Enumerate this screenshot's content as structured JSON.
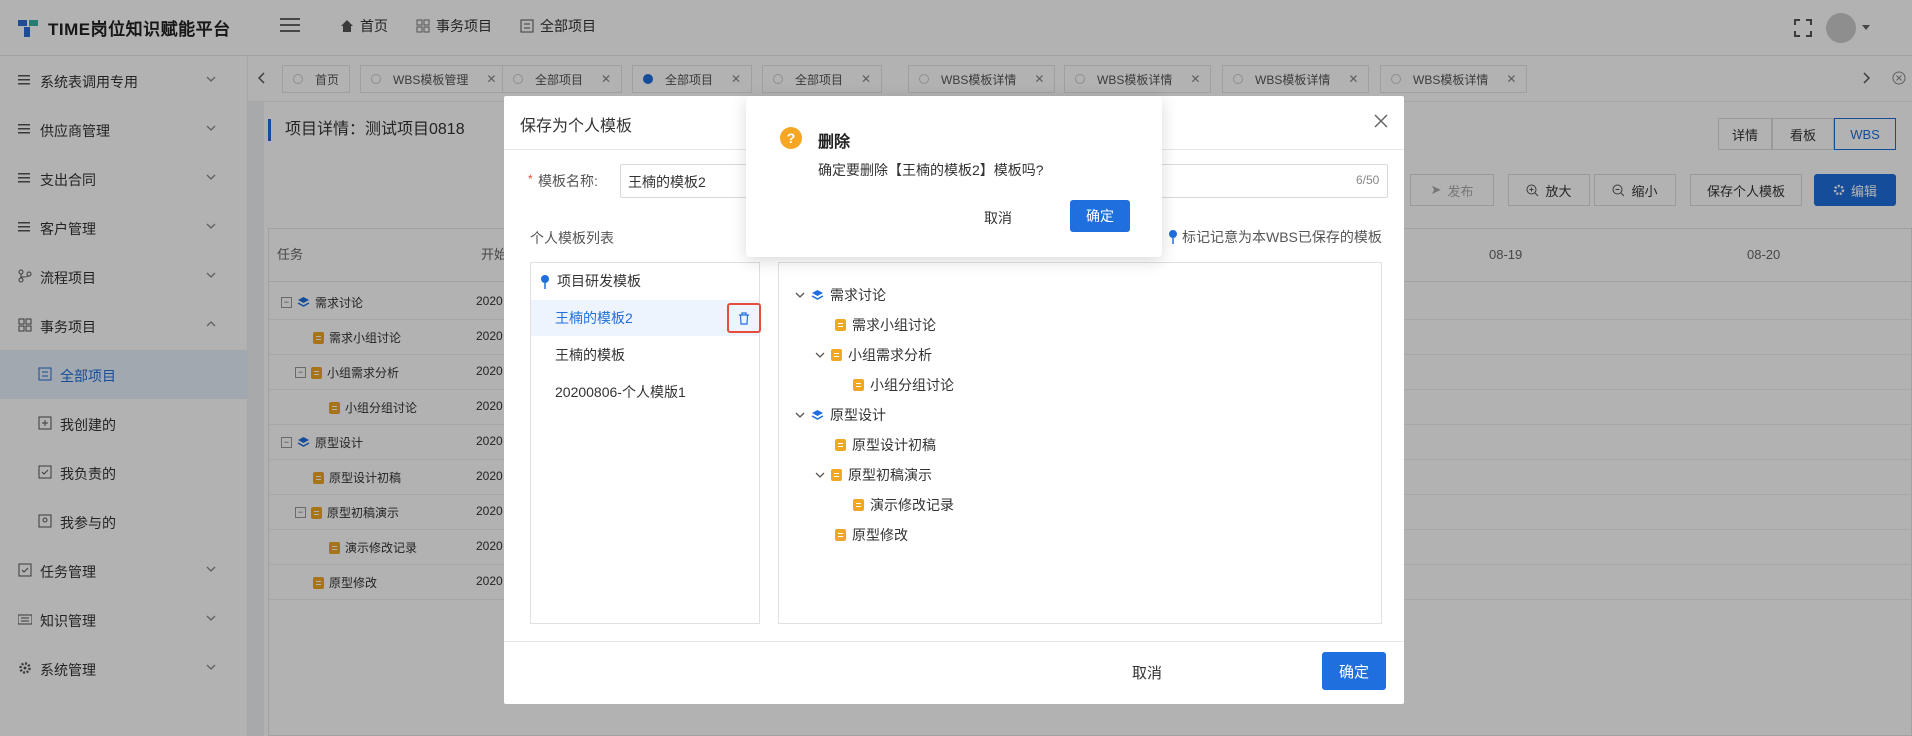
{
  "app": {
    "title": "TIME岗位知识赋能平台"
  },
  "topnav": {
    "home": "首页",
    "affairs": "事务项目",
    "all_projects": "全部项目"
  },
  "sidebar": {
    "items": [
      {
        "label": "系统表调用专用"
      },
      {
        "label": "供应商管理"
      },
      {
        "label": "支出合同"
      },
      {
        "label": "客户管理"
      },
      {
        "label": "流程项目"
      },
      {
        "label": "事务项目"
      },
      {
        "label": "全部项目"
      },
      {
        "label": "我创建的"
      },
      {
        "label": "我负责的"
      },
      {
        "label": "我参与的"
      },
      {
        "label": "任务管理"
      },
      {
        "label": "知识管理"
      },
      {
        "label": "系统管理"
      }
    ]
  },
  "tabs": [
    {
      "label": "首页"
    },
    {
      "label": "WBS模板管理"
    },
    {
      "label": "全部项目"
    },
    {
      "label": "全部项目"
    },
    {
      "label": "全部项目"
    },
    {
      "label": "WBS模板详情"
    },
    {
      "label": "WBS模板详情"
    },
    {
      "label": "WBS模板详情"
    },
    {
      "label": "WBS模板详情"
    }
  ],
  "page": {
    "title": "项目详情：测试项目0818",
    "views": {
      "detail": "详情",
      "board": "看板",
      "wbs": "WBS"
    },
    "toolbar": {
      "publish": "发布",
      "zoom_in": "放大",
      "zoom_out": "缩小",
      "save_personal": "保存个人模板",
      "edit": "编辑"
    },
    "grid": {
      "col_task": "任务",
      "col_start": "开始",
      "dates": [
        "08-19",
        "08-20"
      ],
      "rows": [
        {
          "name": "需求讨论",
          "start": "2020"
        },
        {
          "name": "需求小组讨论",
          "start": "2020"
        },
        {
          "name": "小组需求分析",
          "start": "2020"
        },
        {
          "name": "小组分组讨论",
          "start": "2020"
        },
        {
          "name": "原型设计",
          "start": "2020"
        },
        {
          "name": "原型设计初稿",
          "start": "2020"
        },
        {
          "name": "原型初稿演示",
          "start": "2020"
        },
        {
          "name": "演示修改记录",
          "start": "2020"
        },
        {
          "name": "原型修改",
          "start": "2020"
        }
      ]
    }
  },
  "dialog": {
    "title": "保存为个人模板",
    "name_label": "模板名称:",
    "name_value": "王楠的模板2",
    "name_count": "6/50",
    "list_label": "个人模板列表",
    "hint": "标记记意为本WBS已保存的模板",
    "templates": [
      {
        "label": "项目研发模板"
      },
      {
        "label": "王楠的模板2"
      },
      {
        "label": "王楠的模板"
      },
      {
        "label": "20200806-个人模版1"
      }
    ],
    "tree": [
      {
        "label": "需求讨论"
      },
      {
        "label": "需求小组讨论"
      },
      {
        "label": "小组需求分析"
      },
      {
        "label": "小组分组讨论"
      },
      {
        "label": "原型设计"
      },
      {
        "label": "原型设计初稿"
      },
      {
        "label": "原型初稿演示"
      },
      {
        "label": "演示修改记录"
      },
      {
        "label": "原型修改"
      }
    ],
    "cancel": "取消",
    "ok": "确定"
  },
  "confirm": {
    "title": "删除",
    "message": "确定要删除【王楠的模板2】模板吗?",
    "cancel": "取消",
    "ok": "确定"
  },
  "colors": {
    "primary": "#1f6fde",
    "warning": "#f5a623",
    "danger": "#e74c3c",
    "folder": "#f0a823"
  }
}
